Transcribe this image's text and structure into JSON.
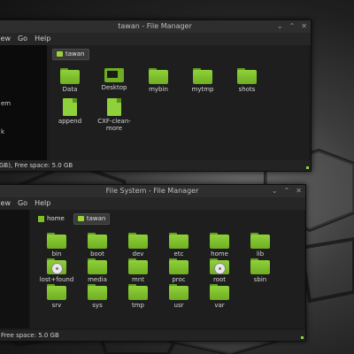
{
  "colors": {
    "accent": "#8fd13a",
    "window_bg": "#1b1b1b",
    "content_bg": "#1e1e1e"
  },
  "window1": {
    "title": "tawan - File Manager",
    "controls": [
      "⌄",
      "⌃",
      "✕"
    ],
    "menu": [
      "View",
      "Go",
      "Help"
    ],
    "side_items": [
      "em",
      "k"
    ],
    "breadcrumb": "tawan",
    "items": [
      {
        "label": "Data",
        "icon": "folder-icon"
      },
      {
        "label": "Desktop",
        "icon": "desktop-folder-icon"
      },
      {
        "label": "mybin",
        "icon": "folder-icon"
      },
      {
        "label": "mytmp",
        "icon": "folder-icon"
      },
      {
        "label": "shots",
        "icon": "folder-icon"
      },
      {
        "label": "append",
        "icon": "file-icon"
      },
      {
        "label": "CXF-clean-more",
        "icon": "file-icon"
      }
    ],
    "status": "GB), Free space: 5.0 GB"
  },
  "window2": {
    "title": "File System - File Manager",
    "controls": [
      "⌄",
      "⌃",
      "✕"
    ],
    "menu": [
      "View",
      "Go",
      "Help"
    ],
    "breadcrumb": [
      "home",
      "tawan"
    ],
    "items": [
      {
        "label": "bin",
        "icon": "folder-icon"
      },
      {
        "label": "boot",
        "icon": "folder-icon"
      },
      {
        "label": "dev",
        "icon": "folder-icon"
      },
      {
        "label": "etc",
        "icon": "folder-icon"
      },
      {
        "label": "home",
        "icon": "folder-icon"
      },
      {
        "label": "lib",
        "icon": "folder-icon"
      },
      {
        "label": "lost+found",
        "icon": "mounted-folder-icon"
      },
      {
        "label": "media",
        "icon": "folder-icon"
      },
      {
        "label": "mnt",
        "icon": "folder-icon"
      },
      {
        "label": "proc",
        "icon": "folder-icon"
      },
      {
        "label": "root",
        "icon": "mounted-folder-icon"
      },
      {
        "label": "sbin",
        "icon": "folder-icon"
      },
      {
        "label": "srv",
        "icon": "folder-icon"
      },
      {
        "label": "sys",
        "icon": "folder-icon"
      },
      {
        "label": "tmp",
        "icon": "folder-icon"
      },
      {
        "label": "usr",
        "icon": "folder-icon"
      },
      {
        "label": "var",
        "icon": "folder-icon"
      }
    ],
    "status": "Free space: 5.0 GB"
  }
}
